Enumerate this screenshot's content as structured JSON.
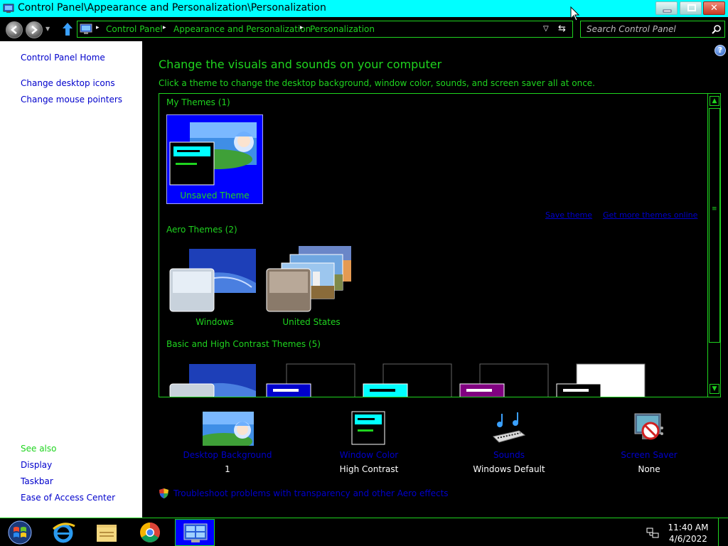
{
  "window": {
    "title": "Control Panel\\Appearance and Personalization\\Personalization",
    "minimize_glyph": "",
    "maximize_glyph": "",
    "close_glyph": "✕"
  },
  "address": {
    "breadcrumbs": [
      "Control Panel",
      "Appearance and Personalization",
      "Personalization"
    ],
    "separator": "▸",
    "search_placeholder": "Search Control Panel"
  },
  "sidebar": {
    "home": "Control Panel Home",
    "links": [
      "Change desktop icons",
      "Change mouse pointers"
    ],
    "see_also_label": "See also",
    "see_also": [
      "Display",
      "Taskbar",
      "Ease of Access Center"
    ]
  },
  "main": {
    "heading": "Change the visuals and sounds on your computer",
    "subheading": "Click a theme to change the desktop background, window color, sounds, and screen saver all at once.",
    "help": "?",
    "my_themes": {
      "title": "My Themes (1)",
      "themes": [
        {
          "label": "Unsaved Theme",
          "selected": true
        }
      ],
      "save_link": "Save theme",
      "online_link": "Get more themes online"
    },
    "aero_themes": {
      "title": "Aero Themes (2)",
      "themes": [
        {
          "label": "Windows"
        },
        {
          "label": "United States"
        }
      ]
    },
    "basic_themes": {
      "title": "Basic and High Contrast Themes (5)",
      "colors": [
        "#0000cc",
        "#00ffff",
        "#800080",
        "#ffffff"
      ]
    }
  },
  "settings": [
    {
      "link": "Desktop Background",
      "value": "1",
      "icon": "desktop-background-icon"
    },
    {
      "link": "Window Color",
      "value": "High Contrast",
      "icon": "window-color-icon"
    },
    {
      "link": "Sounds",
      "value": "Windows Default",
      "icon": "sounds-icon"
    },
    {
      "link": "Screen Saver",
      "value": "None",
      "icon": "screen-saver-icon"
    }
  ],
  "troubleshoot": "Troubleshoot problems with transparency and other Aero effects",
  "taskbar": {
    "items": [
      "start-button",
      "internet-explorer",
      "file-explorer",
      "chrome",
      "control-panel"
    ],
    "time": "11:40 AM",
    "date": "4/6/2022"
  },
  "colors": {
    "accent_green": "#1fd41f",
    "title_bar": "#00ffff",
    "link_blue": "#0000cc",
    "selection_blue": "#0000ff"
  }
}
